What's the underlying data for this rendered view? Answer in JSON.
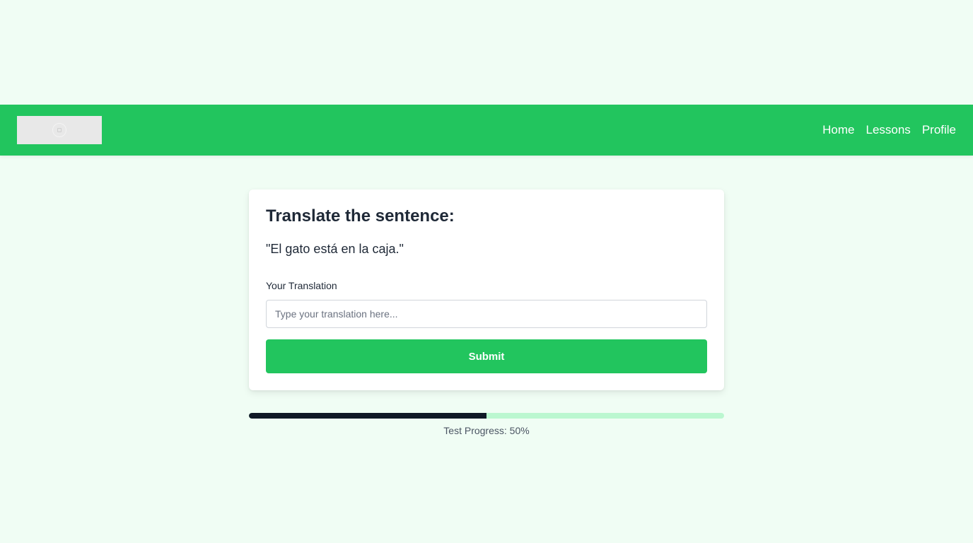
{
  "nav": {
    "links": [
      {
        "label": "Home"
      },
      {
        "label": "Lessons"
      },
      {
        "label": "Profile"
      }
    ]
  },
  "card": {
    "title": "Translate the sentence:",
    "sentence": "\"El gato está en la caja.\"",
    "input_label": "Your Translation",
    "input_placeholder": "Type your translation here...",
    "input_value": "",
    "submit_label": "Submit"
  },
  "progress": {
    "percent": 50,
    "text": "Test Progress: 50%"
  },
  "colors": {
    "accent": "#22c55e",
    "background": "#f0fdf4",
    "progress_fill": "#111827",
    "progress_track": "#bbf7d0"
  }
}
